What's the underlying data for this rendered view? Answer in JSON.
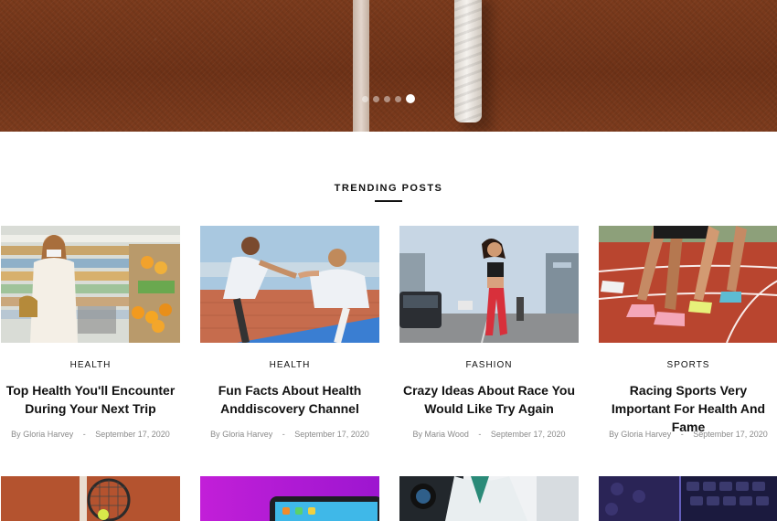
{
  "hero": {
    "slide_count": 5,
    "active_slide_index": 4
  },
  "section": {
    "title": "TRENDING POSTS"
  },
  "posts": [
    {
      "category": "HEALTH",
      "title": "Top Health You'll Encounter During Your Next Trip",
      "author_prefix": "By",
      "author": "Gloria Harvey",
      "separator": "-",
      "date": "September 17, 2020"
    },
    {
      "category": "HEALTH",
      "title": "Fun Facts About Health Anddiscovery Channel",
      "author_prefix": "By",
      "author": "Gloria Harvey",
      "separator": "-",
      "date": "September 17, 2020"
    },
    {
      "category": "FASHION",
      "title": "Crazy Ideas About Race You Would Like Try Again",
      "author_prefix": "By",
      "author": "Maria Wood",
      "separator": "-",
      "date": "September 17, 2020"
    },
    {
      "category": "SPORTS",
      "title": "Racing Sports Very Important For Health And Fame",
      "author_prefix": "By",
      "author": "Gloria Harvey",
      "separator": "-",
      "date": "September 17, 2020"
    }
  ],
  "colors": {
    "hero_clay": "#7a3a1c",
    "text_dark": "#111111",
    "meta_gray": "#8a8a8a"
  }
}
